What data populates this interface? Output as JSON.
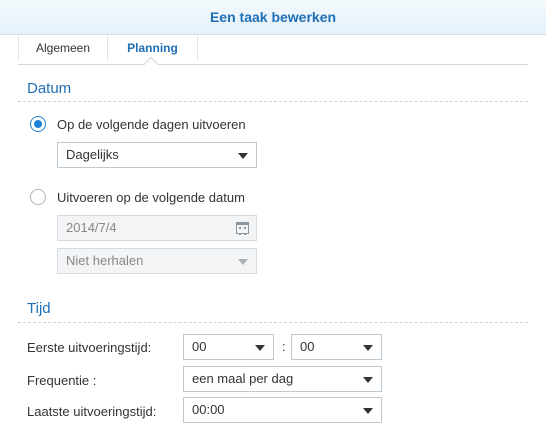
{
  "window": {
    "title": "Een taak bewerken"
  },
  "tabs": [
    {
      "label": "Algemeen",
      "active": false
    },
    {
      "label": "Planning",
      "active": true
    }
  ],
  "date_section": {
    "title": "Datum",
    "option_days": {
      "label": "Op de volgende dagen uitvoeren",
      "selected": true
    },
    "days_select": {
      "value": "Dagelijks"
    },
    "option_date": {
      "label": "Uitvoeren op de volgende datum",
      "selected": false
    },
    "date_field": {
      "value": "2014/7/4",
      "icon": "calendar-icon"
    },
    "repeat_select": {
      "value": "Niet herhalen"
    }
  },
  "time_section": {
    "title": "Tijd",
    "first_run_label": "Eerste uitvoeringstijd:",
    "first_run_hour": "00",
    "time_separator": ":",
    "first_run_minute": "00",
    "frequency_label": "Frequentie :",
    "frequency_value": "een maal per dag",
    "last_run_label": "Laatste uitvoeringstijd:",
    "last_run_value": "00:00"
  },
  "colors": {
    "accent": "#1e6fb5",
    "radio": "#1b82d8"
  }
}
